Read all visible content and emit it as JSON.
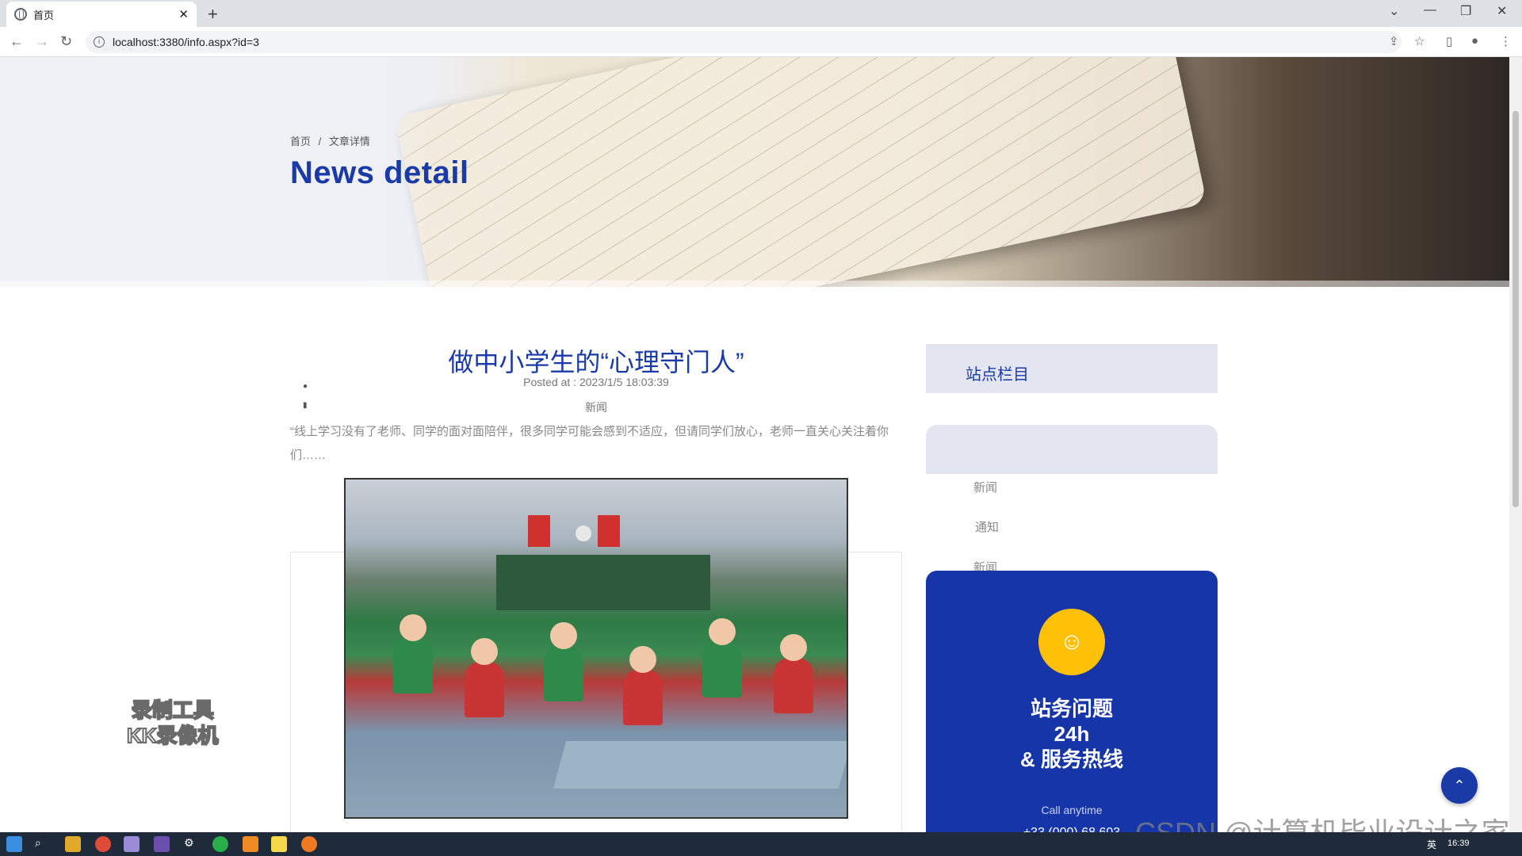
{
  "browser": {
    "tab_title": "首页",
    "tab_close": "✕",
    "new_tab": "+",
    "url": "localhost:3380/info.aspx?id=3",
    "win_min": "—",
    "win_max": "❐",
    "win_close": "✕",
    "tab_list": "⌄"
  },
  "hero": {
    "breadcrumb_home": "首页",
    "breadcrumb_sep": "/",
    "breadcrumb_current": "文章详情",
    "title": "News detail"
  },
  "article": {
    "title": "做中小学生的“心理守门人”",
    "posted": "Posted at : 2023/1/5 18:03:39",
    "category": "新闻",
    "body": "“线上学习没有了老师、同学的面对面陪伴，很多同学可能会感到不适应，但请同学们放心，老师一直关心关注着你们……"
  },
  "sidebar": {
    "heading": "站点栏目",
    "items": [
      {
        "label": "新闻"
      },
      {
        "label": "通知"
      },
      {
        "label": "新闻"
      }
    ]
  },
  "help": {
    "icon": "☺",
    "title_line1": "站务问题",
    "title_line2": "24h",
    "title_line3": "& 服务热线",
    "call": "Call anytime",
    "phone": "+33 (000) 68 603"
  },
  "overlay": {
    "wm_line1": "录制工具",
    "wm_line2": "KK录像机",
    "csdn": "CSDN @计算机毕业设计之家"
  },
  "taskbar": {
    "time": "16:39",
    "lang": "英"
  },
  "to_top": "⌃"
}
